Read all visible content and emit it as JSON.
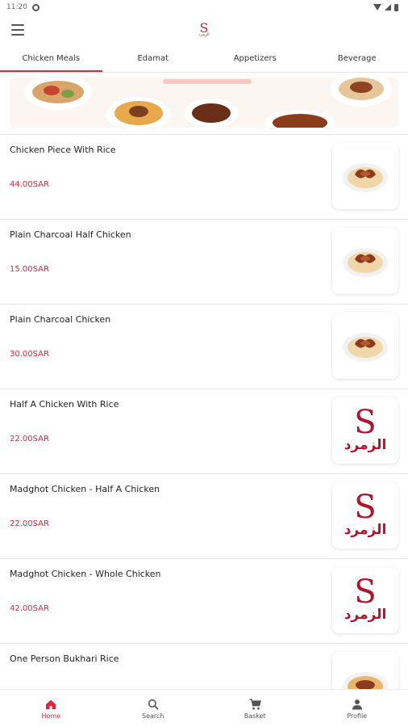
{
  "status_bar": {
    "time": "11:20",
    "settings_icon": "gear-icon",
    "wifi_icon": "wifi-icon",
    "signal_icon": "signal-icon",
    "battery_icon": "battery-icon"
  },
  "app_bar": {
    "menu_icon": "hamburger-menu-icon",
    "logo_letter": "S",
    "logo_text": "الزمرد"
  },
  "tabs": [
    {
      "label": "Chicken Meals",
      "active": true
    },
    {
      "label": "Edamat",
      "active": false
    },
    {
      "label": "Appetizers",
      "active": false
    },
    {
      "label": "Beverage",
      "active": false
    }
  ],
  "menu_items": [
    {
      "name": "Chicken Piece With Rice",
      "price": "44.00SAR",
      "image": "chicken-rice-photo"
    },
    {
      "name": "Plain Charcoal Half Chicken",
      "price": "15.00SAR",
      "image": "chicken-rice-photo"
    },
    {
      "name": "Plain Charcoal Chicken",
      "price": "30.00SAR",
      "image": "chicken-rice-photo"
    },
    {
      "name": "Half A Chicken With Rice",
      "price": "22.00SAR",
      "image": "brand-logo"
    },
    {
      "name": "Madghot Chicken - Half A Chicken",
      "price": "22.00SAR",
      "image": "brand-logo"
    },
    {
      "name": "Madghot Chicken - Whole Chicken",
      "price": "42.00SAR",
      "image": "brand-logo"
    },
    {
      "name": "One Person Bukhari Rice",
      "price": "",
      "image": "chicken-rice-photo"
    }
  ],
  "brand": {
    "letter": "S",
    "arabic": "الزمرد"
  },
  "bottom_nav": [
    {
      "label": "Home",
      "icon": "home-icon",
      "active": true
    },
    {
      "label": "Search",
      "icon": "search-icon",
      "active": false
    },
    {
      "label": "Basket",
      "icon": "cart-icon",
      "active": false
    },
    {
      "label": "Profile",
      "icon": "person-icon",
      "active": false
    }
  ],
  "colors": {
    "accent": "#e8223a",
    "brand": "#b3122b",
    "divider": "#e6e6e6"
  }
}
